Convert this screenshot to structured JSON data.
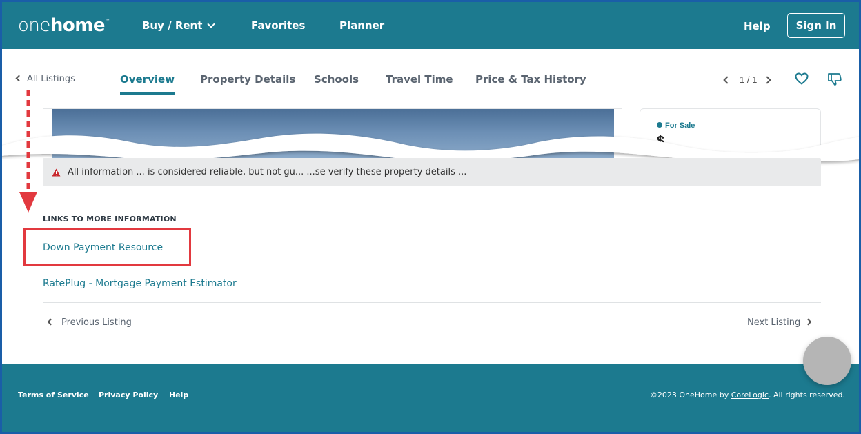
{
  "header": {
    "logo_part1": "one",
    "logo_part2": "home",
    "logo_tm": "™",
    "nav": {
      "buy_rent": "Buy / Rent",
      "favorites": "Favorites",
      "planner": "Planner",
      "help": "Help"
    },
    "sign_in": "Sign In"
  },
  "subnav": {
    "back": "All Listings",
    "tabs": [
      {
        "label": "Overview",
        "active": true
      },
      {
        "label": "Property Details",
        "active": false
      },
      {
        "label": "Schools",
        "active": false
      },
      {
        "label": "Travel Time",
        "active": false
      },
      {
        "label": "Price & Tax History",
        "active": false
      }
    ],
    "pager": "1 / 1"
  },
  "listing": {
    "status": "For Sale",
    "price_partial": "$"
  },
  "disclaimer": "All information ... is considered reliable, but not gu... ...se verify these property details ...",
  "links_section": {
    "heading": "LINKS TO MORE INFORMATION",
    "links": [
      "Down Payment Resource",
      "RatePlug - Mortgage Payment Estimator"
    ]
  },
  "listing_nav": {
    "previous": "Previous Listing",
    "next": "Next Listing"
  },
  "footer": {
    "links": [
      "Terms of Service",
      "Privacy Policy",
      "Help"
    ],
    "copyright_pre": "©2023 OneHome by ",
    "copyright_link": "CoreLogic",
    "copyright_post": ". All rights reserved."
  },
  "colors": {
    "brand_teal": "#1c7a8f",
    "annotation_red": "#e2393f",
    "frame_blue": "#1a5ea8"
  }
}
